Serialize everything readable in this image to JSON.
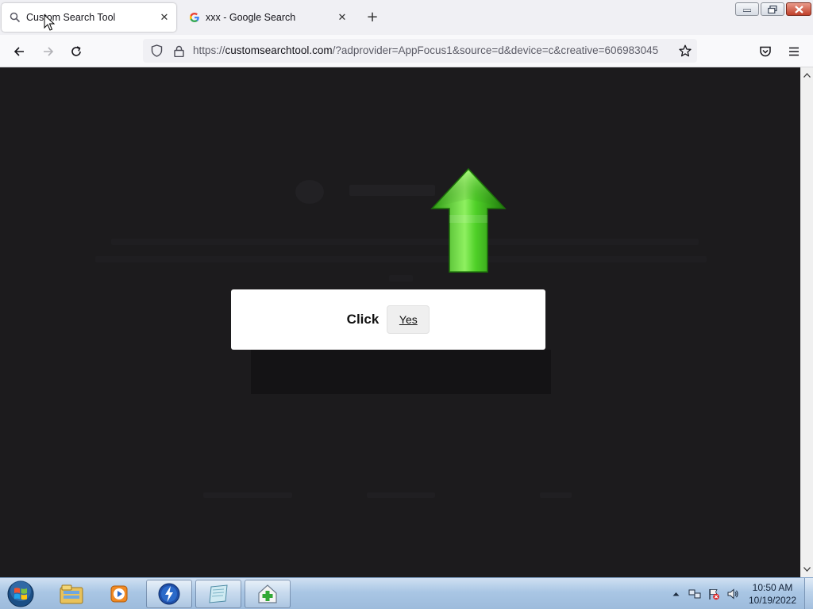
{
  "window": {
    "tabs": [
      {
        "title": "Custom Search Tool",
        "icon": "search-icon",
        "active": true
      },
      {
        "title": "xxx - Google Search",
        "icon": "google-favicon",
        "active": false
      }
    ],
    "close_glyph": "✕",
    "new_tab_glyph": "+"
  },
  "navbar": {
    "url_prefix": "https://",
    "url_host": "customsearchtool.com",
    "url_rest": "/?adprovider=AppFocus1&source=d&device=c&creative=606983045"
  },
  "page": {
    "dialog": {
      "label": "Click",
      "button": "Yes"
    },
    "arrow_color": "#3fbf1f",
    "background": "#1c1b1d"
  },
  "taskbar": {
    "pinned": [
      "windows-explorer-icon",
      "media-player-icon",
      "thunder-app-icon",
      "notepad-icon",
      "installer-icon"
    ],
    "clock_time": "10:50 AM",
    "clock_date": "10/19/2022"
  },
  "colors": {
    "accent": "#2b6ac9",
    "taskbar": "#a9c6e4"
  }
}
